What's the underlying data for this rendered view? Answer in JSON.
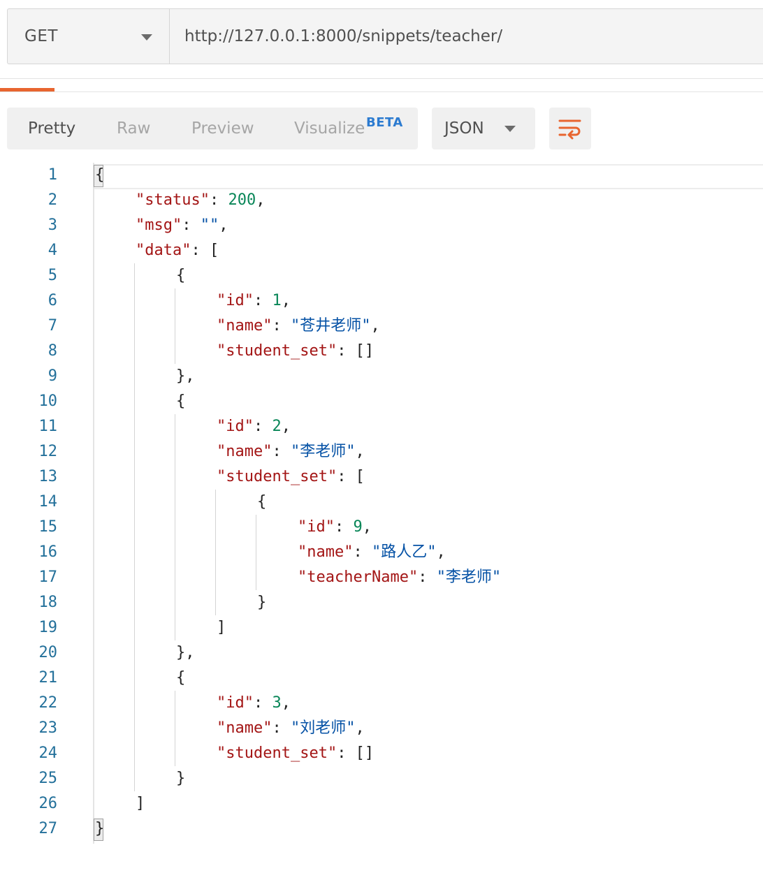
{
  "request": {
    "method": "GET",
    "url": "http://127.0.0.1:8000/snippets/teacher/"
  },
  "response_toolbar": {
    "view_tabs": [
      "Pretty",
      "Raw",
      "Preview",
      "Visualize"
    ],
    "active_view": "Pretty",
    "beta_badge": "BETA",
    "format": "JSON",
    "wrap_icon": "wrap-lines-icon",
    "accent_color": "#e8652f"
  },
  "code": {
    "line_numbers": [
      "1",
      "2",
      "3",
      "4",
      "5",
      "6",
      "7",
      "8",
      "9",
      "10",
      "11",
      "12",
      "13",
      "14",
      "15",
      "16",
      "17",
      "18",
      "19",
      "20",
      "21",
      "22",
      "23",
      "24",
      "25",
      "26",
      "27"
    ],
    "lines": [
      [
        {
          "t": "p",
          "v": "{"
        }
      ],
      [
        {
          "t": "k",
          "v": "\"status\""
        },
        {
          "t": "p",
          "v": ": "
        },
        {
          "t": "n",
          "v": "200"
        },
        {
          "t": "p",
          "v": ","
        }
      ],
      [
        {
          "t": "k",
          "v": "\"msg\""
        },
        {
          "t": "p",
          "v": ": "
        },
        {
          "t": "s",
          "v": "\"\""
        },
        {
          "t": "p",
          "v": ","
        }
      ],
      [
        {
          "t": "k",
          "v": "\"data\""
        },
        {
          "t": "p",
          "v": ": ["
        }
      ],
      [
        {
          "t": "p",
          "v": "{"
        }
      ],
      [
        {
          "t": "k",
          "v": "\"id\""
        },
        {
          "t": "p",
          "v": ": "
        },
        {
          "t": "n",
          "v": "1"
        },
        {
          "t": "p",
          "v": ","
        }
      ],
      [
        {
          "t": "k",
          "v": "\"name\""
        },
        {
          "t": "p",
          "v": ": "
        },
        {
          "t": "s",
          "v": "\"苍井老师\""
        },
        {
          "t": "p",
          "v": ","
        }
      ],
      [
        {
          "t": "k",
          "v": "\"student_set\""
        },
        {
          "t": "p",
          "v": ": []"
        }
      ],
      [
        {
          "t": "p",
          "v": "},"
        }
      ],
      [
        {
          "t": "p",
          "v": "{"
        }
      ],
      [
        {
          "t": "k",
          "v": "\"id\""
        },
        {
          "t": "p",
          "v": ": "
        },
        {
          "t": "n",
          "v": "2"
        },
        {
          "t": "p",
          "v": ","
        }
      ],
      [
        {
          "t": "k",
          "v": "\"name\""
        },
        {
          "t": "p",
          "v": ": "
        },
        {
          "t": "s",
          "v": "\"李老师\""
        },
        {
          "t": "p",
          "v": ","
        }
      ],
      [
        {
          "t": "k",
          "v": "\"student_set\""
        },
        {
          "t": "p",
          "v": ": ["
        }
      ],
      [
        {
          "t": "p",
          "v": "{"
        }
      ],
      [
        {
          "t": "k",
          "v": "\"id\""
        },
        {
          "t": "p",
          "v": ": "
        },
        {
          "t": "n",
          "v": "9"
        },
        {
          "t": "p",
          "v": ","
        }
      ],
      [
        {
          "t": "k",
          "v": "\"name\""
        },
        {
          "t": "p",
          "v": ": "
        },
        {
          "t": "s",
          "v": "\"路人乙\""
        },
        {
          "t": "p",
          "v": ","
        }
      ],
      [
        {
          "t": "k",
          "v": "\"teacherName\""
        },
        {
          "t": "p",
          "v": ": "
        },
        {
          "t": "s",
          "v": "\"李老师\""
        }
      ],
      [
        {
          "t": "p",
          "v": "}"
        }
      ],
      [
        {
          "t": "p",
          "v": "]"
        }
      ],
      [
        {
          "t": "p",
          "v": "},"
        }
      ],
      [
        {
          "t": "p",
          "v": "{"
        }
      ],
      [
        {
          "t": "k",
          "v": "\"id\""
        },
        {
          "t": "p",
          "v": ": "
        },
        {
          "t": "n",
          "v": "3"
        },
        {
          "t": "p",
          "v": ","
        }
      ],
      [
        {
          "t": "k",
          "v": "\"name\""
        },
        {
          "t": "p",
          "v": ": "
        },
        {
          "t": "s",
          "v": "\"刘老师\""
        },
        {
          "t": "p",
          "v": ","
        }
      ],
      [
        {
          "t": "k",
          "v": "\"student_set\""
        },
        {
          "t": "p",
          "v": ": []"
        }
      ],
      [
        {
          "t": "p",
          "v": "}"
        }
      ],
      [
        {
          "t": "p",
          "v": "]"
        }
      ],
      [
        {
          "t": "p",
          "v": "}"
        }
      ]
    ],
    "colors": {
      "key": "#a31515",
      "number": "#098658",
      "string": "#0451a5",
      "line_number": "#23709a"
    }
  }
}
